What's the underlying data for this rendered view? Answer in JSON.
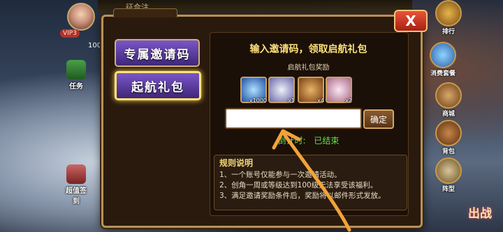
{
  "hud": {
    "vip": "VIP3",
    "level_num": "100",
    "left_task": "任务",
    "left_bottom": "超值签到",
    "top_title": "征合注",
    "right_ranking": "排行",
    "right_consume": "消费套餐",
    "right_shop": "商城",
    "right_bag": "背包",
    "right_formation": "阵型",
    "fight": "出战"
  },
  "dialog": {
    "close_label": "X",
    "tab_invite_code": "专属邀请码",
    "tab_launch_pack": "起航礼包",
    "heading": "输入邀请码，领取启航礼包",
    "subheading": "启航礼包奖励",
    "rewards": [
      {
        "icon": "diamond-icon",
        "qty": "x1000"
      },
      {
        "icon": "hero-portrait-icon",
        "qty": "x1"
      },
      {
        "icon": "treasure-chest-icon",
        "qty": "x4"
      },
      {
        "icon": "pet-portrait-icon",
        "qty": "x2"
      }
    ],
    "input_value": "",
    "confirm_label": "确定",
    "countdown_label": "倒计时:",
    "countdown_value": "已结束",
    "rules_title": "规则说明",
    "rules": [
      "1、一个账号仅能参与一次邀请活动。",
      "2、创角一周或等级达到100级无法享受该福利。",
      "3、满足邀请奖励条件后，奖励将以邮件形式发放。"
    ]
  }
}
